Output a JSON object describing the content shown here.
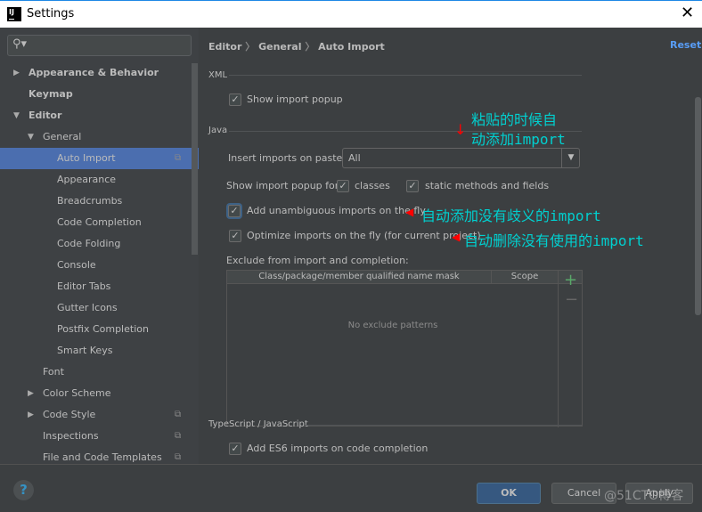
{
  "window": {
    "title": "Settings",
    "app_icon_text": "IJ",
    "close": "✕"
  },
  "sidebar": {
    "search_placeholder": "",
    "items": [
      {
        "label": "Appearance & Behavior",
        "level": 0,
        "expanded": false,
        "bold": true
      },
      {
        "label": "Keymap",
        "level": 0,
        "bold": true
      },
      {
        "label": "Editor",
        "level": 0,
        "expanded": true,
        "bold": true
      },
      {
        "label": "General",
        "level": 1,
        "expanded": true
      },
      {
        "label": "Auto Import",
        "level": 2,
        "selected": true,
        "copy_icon": true
      },
      {
        "label": "Appearance",
        "level": 2
      },
      {
        "label": "Breadcrumbs",
        "level": 2
      },
      {
        "label": "Code Completion",
        "level": 2
      },
      {
        "label": "Code Folding",
        "level": 2
      },
      {
        "label": "Console",
        "level": 2
      },
      {
        "label": "Editor Tabs",
        "level": 2
      },
      {
        "label": "Gutter Icons",
        "level": 2
      },
      {
        "label": "Postfix Completion",
        "level": 2
      },
      {
        "label": "Smart Keys",
        "level": 2
      },
      {
        "label": "Font",
        "level": 1
      },
      {
        "label": "Color Scheme",
        "level": 1,
        "expanded": false
      },
      {
        "label": "Code Style",
        "level": 1,
        "expanded": false,
        "copy_icon": true
      },
      {
        "label": "Inspections",
        "level": 1,
        "copy_icon": true
      },
      {
        "label": "File and Code Templates",
        "level": 1,
        "copy_icon": true
      }
    ]
  },
  "breadcrumb": [
    "Editor",
    "General",
    "Auto Import"
  ],
  "reset": "Reset",
  "xml": {
    "title": "XML",
    "show_popup": {
      "label": "Show import popup",
      "checked": true
    }
  },
  "java": {
    "title": "Java",
    "insert_label": "Insert imports on paste:",
    "insert_value": "All",
    "popup_for_label": "Show import popup for:",
    "classes": {
      "label": "classes",
      "checked": true
    },
    "static": {
      "label": "static methods and fields",
      "checked": true
    },
    "unambiguous": {
      "label": "Add unambiguous imports on the fly",
      "checked": true
    },
    "optimize": {
      "label": "Optimize imports on the fly (for current project)",
      "checked": true
    },
    "exclude_label": "Exclude from import and completion:",
    "table": {
      "col1": "Class/package/member qualified name mask",
      "col2": "Scope",
      "empty": "No exclude patterns"
    }
  },
  "ts": {
    "title": "TypeScript / JavaScript",
    "es6": {
      "label": "Add ES6 imports on code completion",
      "checked": true
    }
  },
  "annotations": {
    "paste_line1": "粘贴的时候自",
    "paste_line2": "动添加import",
    "unambiguous": "自动添加没有歧义的import",
    "optimize": "自动删除没有使用的import"
  },
  "footer": {
    "ok": "OK",
    "cancel": "Cancel",
    "apply": "Apply",
    "help": "?",
    "watermark": "@51CTO博客"
  },
  "colors": {
    "accent": "#4b6eaf",
    "link": "#589df6",
    "annotation": "#00d0d0",
    "arrow": "#ff0000"
  }
}
